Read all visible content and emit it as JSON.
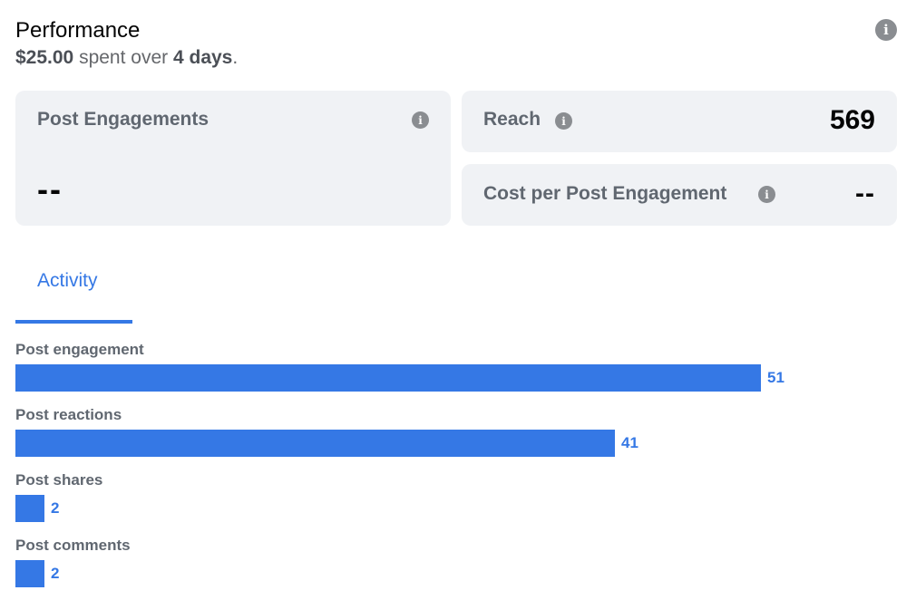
{
  "header": {
    "title": "Performance",
    "spent_amount": "$25.00",
    "spent_text": "spent over",
    "duration": "4 days",
    "period": "."
  },
  "cards": {
    "post_engagements": {
      "label": "Post Engagements",
      "value": "--"
    },
    "reach": {
      "label": "Reach",
      "value": "569"
    },
    "cost_per_engagement": {
      "label": "Cost per Post Engagement",
      "value": "--"
    }
  },
  "tabs": [
    {
      "label": "Activity",
      "active": true
    }
  ],
  "activity": {
    "max": 51,
    "metrics": [
      {
        "label": "Post engagement",
        "value": 51
      },
      {
        "label": "Post reactions",
        "value": 41
      },
      {
        "label": "Post shares",
        "value": 2
      },
      {
        "label": "Post comments",
        "value": 2
      }
    ]
  },
  "colors": {
    "accent": "#3578e5",
    "card_bg": "#f0f2f5",
    "muted_text": "#606770",
    "icon_gray": "#8a8d91"
  },
  "icons": {
    "info": "info-icon"
  }
}
